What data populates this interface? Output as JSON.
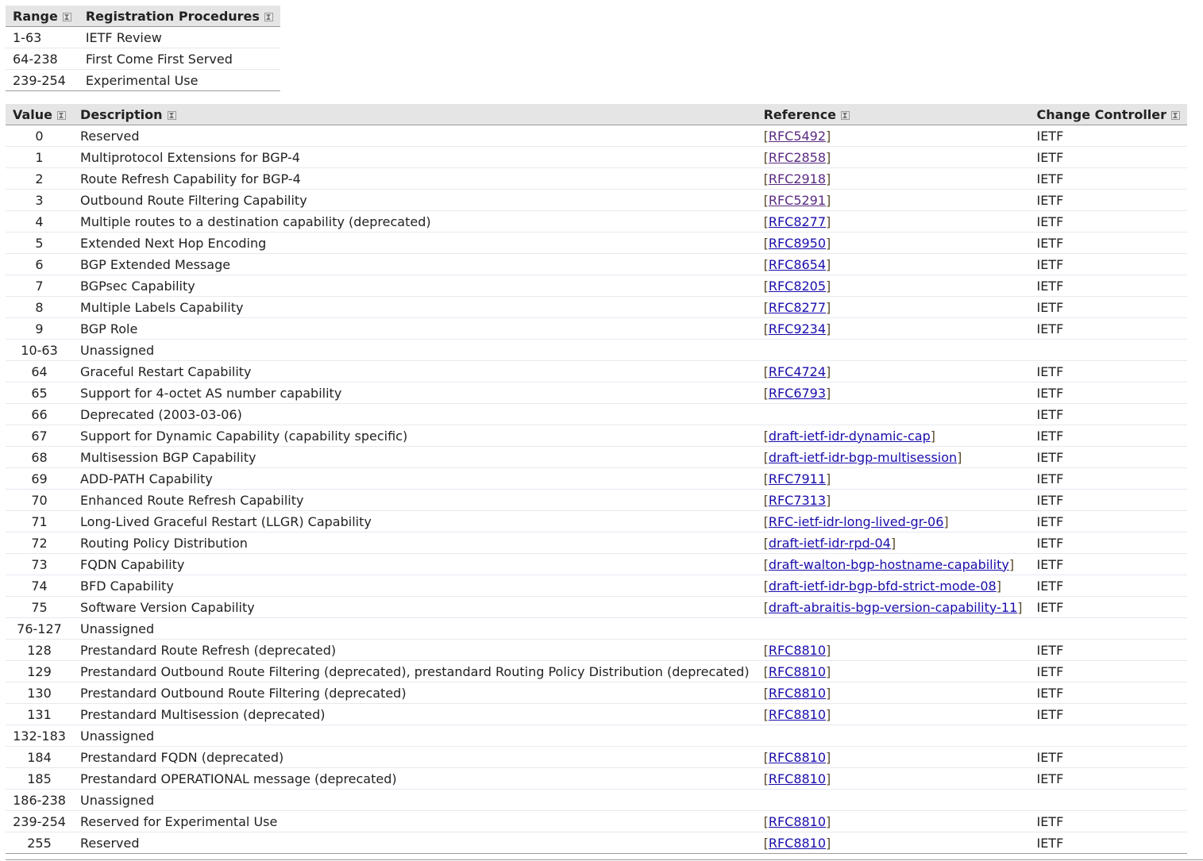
{
  "registration_table": {
    "headers": [
      "Range",
      "Registration Procedures"
    ],
    "rows": [
      {
        "range": "1-63",
        "procedure": "IETF Review"
      },
      {
        "range": "64-238",
        "procedure": "First Come First Served"
      },
      {
        "range": "239-254",
        "procedure": "Experimental Use"
      }
    ]
  },
  "main_table": {
    "headers": [
      "Value",
      "Description",
      "Reference",
      "Change Controller"
    ],
    "rows": [
      {
        "value": "0",
        "description": "Reserved",
        "reference": "RFC5492",
        "visited": true,
        "controller": "IETF"
      },
      {
        "value": "1",
        "description": "Multiprotocol Extensions for BGP-4",
        "reference": "RFC2858",
        "visited": true,
        "controller": "IETF"
      },
      {
        "value": "2",
        "description": "Route Refresh Capability for BGP-4",
        "reference": "RFC2918",
        "visited": true,
        "controller": "IETF"
      },
      {
        "value": "3",
        "description": "Outbound Route Filtering Capability",
        "reference": "RFC5291",
        "visited": true,
        "controller": "IETF"
      },
      {
        "value": "4",
        "description": "Multiple routes to a destination capability (deprecated)",
        "reference": "RFC8277",
        "controller": "IETF"
      },
      {
        "value": "5",
        "description": "Extended Next Hop Encoding",
        "reference": "RFC8950",
        "controller": "IETF"
      },
      {
        "value": "6",
        "description": "BGP Extended Message",
        "reference": "RFC8654",
        "controller": "IETF"
      },
      {
        "value": "7",
        "description": "BGPsec Capability",
        "reference": "RFC8205",
        "controller": "IETF"
      },
      {
        "value": "8",
        "description": "Multiple Labels Capability",
        "reference": "RFC8277",
        "controller": "IETF"
      },
      {
        "value": "9",
        "description": "BGP Role",
        "reference": "RFC9234",
        "controller": "IETF"
      },
      {
        "value": "10-63",
        "description": "Unassigned",
        "reference": "",
        "controller": ""
      },
      {
        "value": "64",
        "description": "Graceful Restart Capability",
        "reference": "RFC4724",
        "controller": "IETF"
      },
      {
        "value": "65",
        "description": "Support for 4-octet AS number capability",
        "reference": "RFC6793",
        "controller": "IETF"
      },
      {
        "value": "66",
        "description": "Deprecated (2003-03-06)",
        "reference": "",
        "controller": "IETF"
      },
      {
        "value": "67",
        "description": "Support for Dynamic Capability (capability specific)",
        "reference": "draft-ietf-idr-dynamic-cap",
        "controller": "IETF"
      },
      {
        "value": "68",
        "description": "Multisession BGP Capability",
        "reference": "draft-ietf-idr-bgp-multisession",
        "controller": "IETF"
      },
      {
        "value": "69",
        "description": "ADD-PATH Capability",
        "reference": "RFC7911",
        "controller": "IETF"
      },
      {
        "value": "70",
        "description": "Enhanced Route Refresh Capability",
        "reference": "RFC7313",
        "controller": "IETF"
      },
      {
        "value": "71",
        "description": "Long-Lived Graceful Restart (LLGR) Capability",
        "reference": "RFC-ietf-idr-long-lived-gr-06",
        "controller": "IETF"
      },
      {
        "value": "72",
        "description": "Routing Policy Distribution",
        "reference": "draft-ietf-idr-rpd-04",
        "controller": "IETF"
      },
      {
        "value": "73",
        "description": "FQDN Capability",
        "reference": "draft-walton-bgp-hostname-capability",
        "controller": "IETF"
      },
      {
        "value": "74",
        "description": "BFD Capability",
        "reference": "draft-ietf-idr-bgp-bfd-strict-mode-08",
        "controller": "IETF"
      },
      {
        "value": "75",
        "description": "Software Version Capability",
        "reference": "draft-abraitis-bgp-version-capability-11",
        "controller": "IETF"
      },
      {
        "value": "76-127",
        "description": "Unassigned",
        "reference": "",
        "controller": ""
      },
      {
        "value": "128",
        "description": "Prestandard Route Refresh (deprecated)",
        "reference": "RFC8810",
        "controller": "IETF"
      },
      {
        "value": "129",
        "description": "Prestandard Outbound Route Filtering (deprecated), prestandard Routing Policy Distribution (deprecated)",
        "reference": "RFC8810",
        "controller": "IETF"
      },
      {
        "value": "130",
        "description": "Prestandard Outbound Route Filtering (deprecated)",
        "reference": "RFC8810",
        "controller": "IETF"
      },
      {
        "value": "131",
        "description": "Prestandard Multisession (deprecated)",
        "reference": "RFC8810",
        "controller": "IETF"
      },
      {
        "value": "132-183",
        "description": "Unassigned",
        "reference": "",
        "controller": ""
      },
      {
        "value": "184",
        "description": "Prestandard FQDN (deprecated)",
        "reference": "RFC8810",
        "controller": "IETF"
      },
      {
        "value": "185",
        "description": "Prestandard OPERATIONAL message (deprecated)",
        "reference": "RFC8810",
        "controller": "IETF"
      },
      {
        "value": "186-238",
        "description": "Unassigned",
        "reference": "",
        "controller": ""
      },
      {
        "value": "239-254",
        "description": "Reserved for Experimental Use",
        "reference": "RFC8810",
        "controller": "IETF"
      },
      {
        "value": "255",
        "description": "Reserved",
        "reference": "RFC8810",
        "controller": "IETF"
      }
    ]
  }
}
